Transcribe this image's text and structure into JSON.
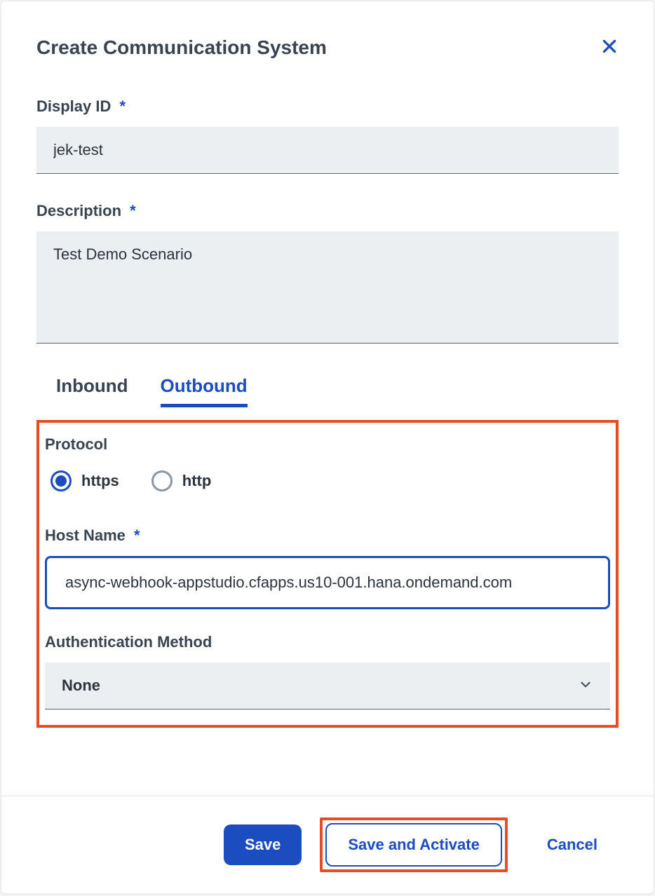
{
  "dialog": {
    "title": "Create Communication System"
  },
  "fields": {
    "display_id": {
      "label": "Display ID",
      "value": "jek-test"
    },
    "description": {
      "label": "Description",
      "value": "Test Demo Scenario"
    },
    "host_name": {
      "label": "Host Name",
      "value": "async-webhook-appstudio.cfapps.us10-001.hana.ondemand.com"
    },
    "auth_method": {
      "label": "Authentication Method",
      "value": "None"
    },
    "protocol": {
      "label": "Protocol",
      "options": {
        "https": "https",
        "http": "http"
      },
      "selected": "https"
    }
  },
  "tabs": {
    "inbound": "Inbound",
    "outbound": "Outbound"
  },
  "footer": {
    "save": "Save",
    "save_activate": "Save and Activate",
    "cancel": "Cancel"
  }
}
